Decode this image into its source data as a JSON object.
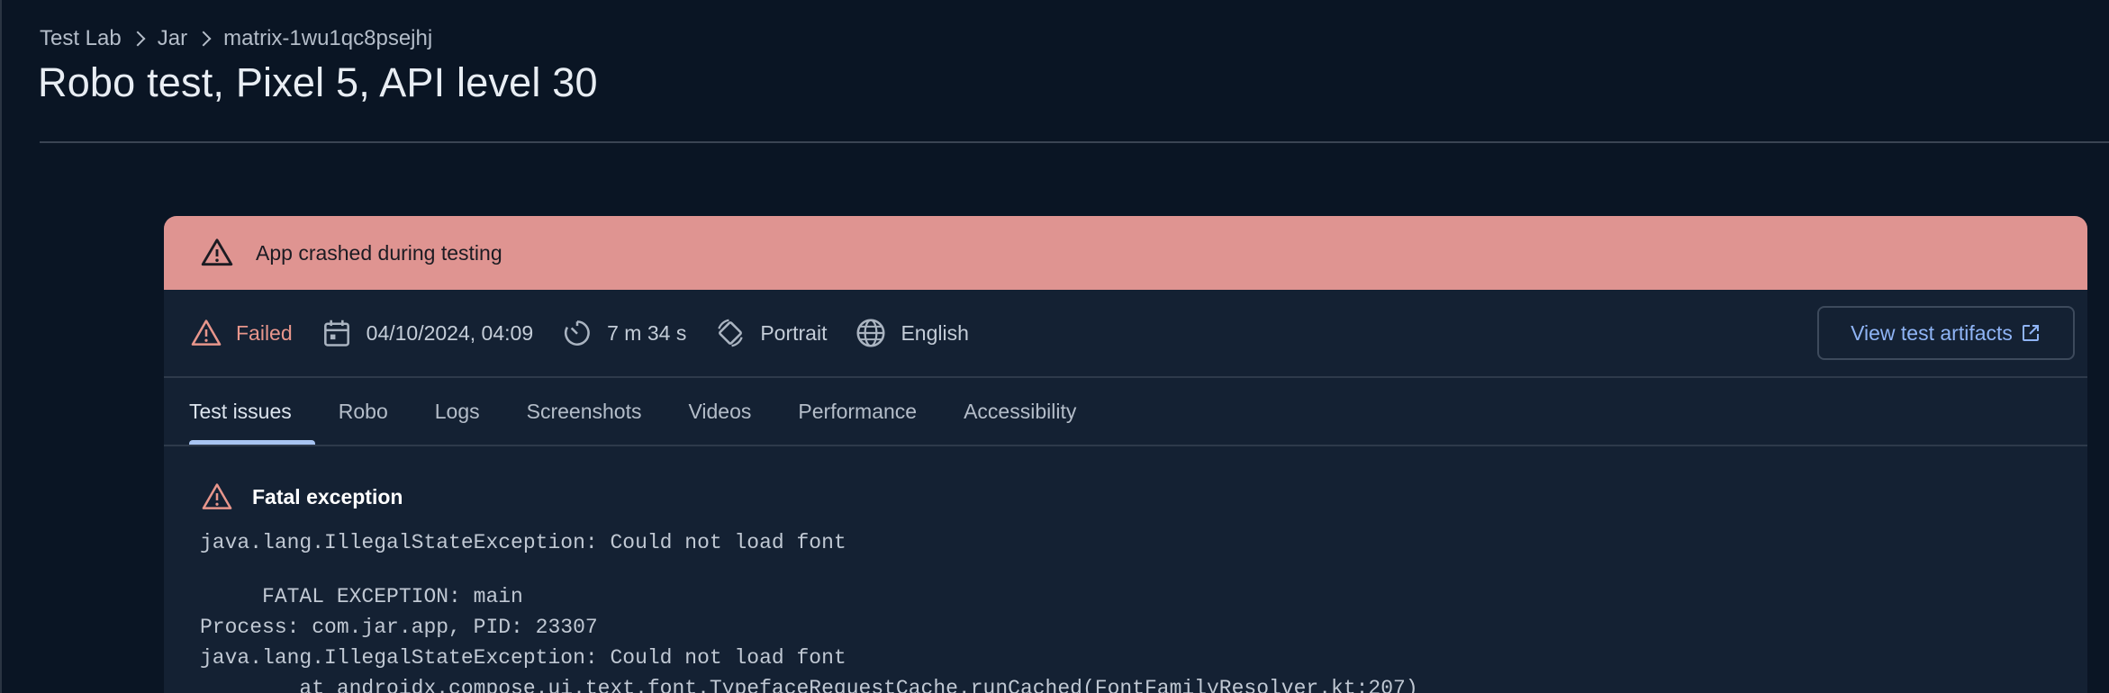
{
  "breadcrumb": [
    "Test Lab",
    "Jar",
    "matrix-1wu1qc8psejhj"
  ],
  "page_title": "Robo test, Pixel 5, API level 30",
  "alert": {
    "text": "App crashed during testing",
    "color": "#df9491"
  },
  "summary": {
    "status": "Failed",
    "date": "04/10/2024, 04:09",
    "duration": "7 m 34 s",
    "orientation": "Portrait",
    "locale": "English",
    "artifacts_button": "View test artifacts"
  },
  "tabs": [
    "Test issues",
    "Robo",
    "Logs",
    "Screenshots",
    "Videos",
    "Performance",
    "Accessibility"
  ],
  "active_tab": "Test issues",
  "issue": {
    "title": "Fatal exception",
    "exception": "java.lang.IllegalStateException: Could not load font",
    "trace": [
      "     FATAL EXCEPTION: main",
      "Process: com.jar.app, PID: 23307",
      "java.lang.IllegalStateException: Could not load font",
      "        at androidx.compose.ui.text.font.TypefaceRequestCache.runCached(FontFamilyResolver.kt:207)"
    ]
  },
  "colors": {
    "background": "#0a1524",
    "card": "#142133",
    "accent": "#8fb4f5",
    "error": "#e8968c"
  }
}
